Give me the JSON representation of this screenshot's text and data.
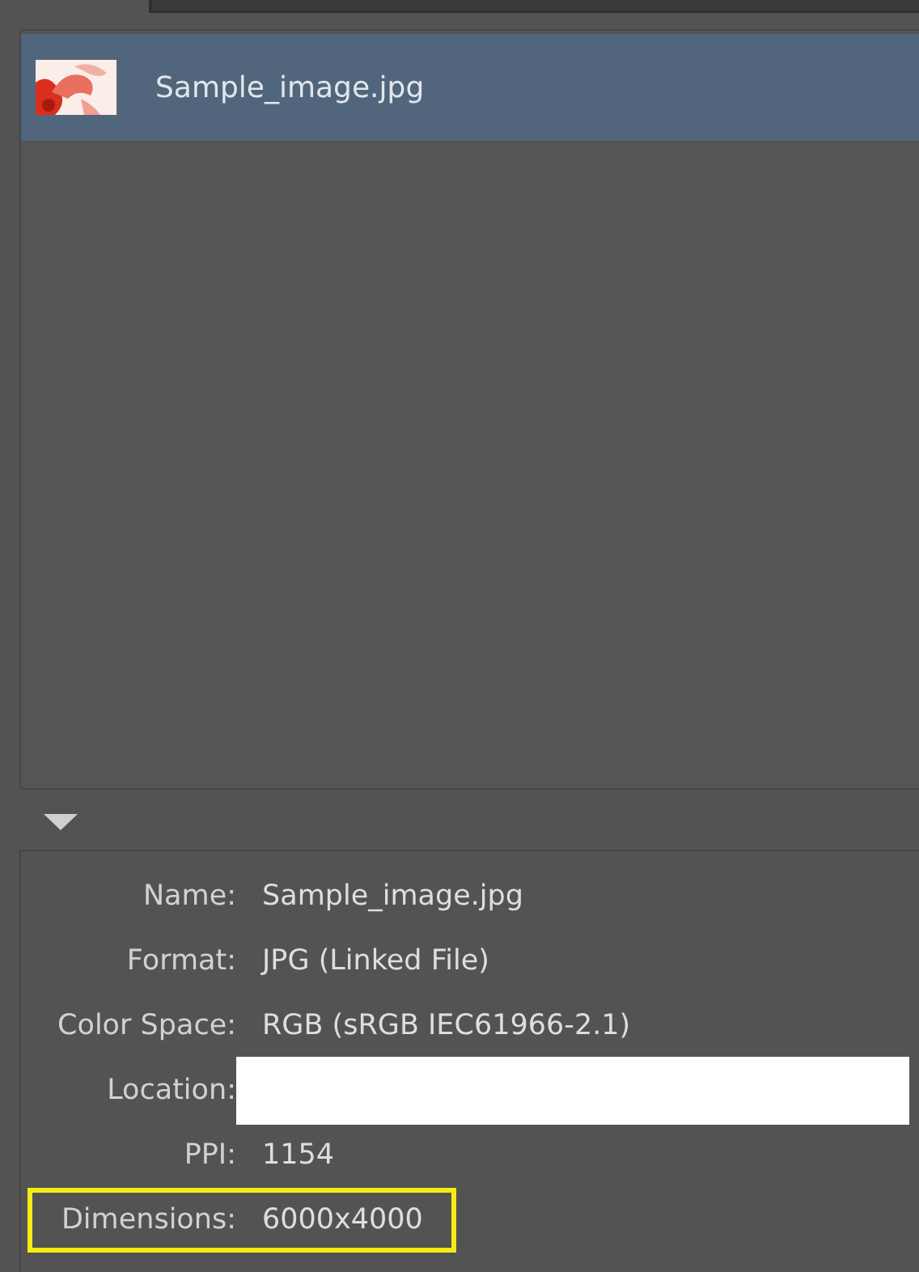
{
  "files": [
    {
      "name": "Sample_image.jpg",
      "selected": true
    }
  ],
  "info_expanded": true,
  "info": [
    {
      "label": "Name:",
      "value": "Sample_image.jpg",
      "kind": "text",
      "highlighted": false
    },
    {
      "label": "Format:",
      "value": "JPG (Linked File)",
      "kind": "text",
      "highlighted": false
    },
    {
      "label": "Color Space:",
      "value": "RGB (sRGB IEC61966-2.1)",
      "kind": "text",
      "highlighted": false
    },
    {
      "label": "Location:",
      "kind": "redacted",
      "highlighted": false
    },
    {
      "label": "PPI:",
      "value": "1154",
      "kind": "text",
      "highlighted": false
    },
    {
      "label": "Dimensions:",
      "value": "6000x4000",
      "kind": "text",
      "highlighted": true
    }
  ]
}
